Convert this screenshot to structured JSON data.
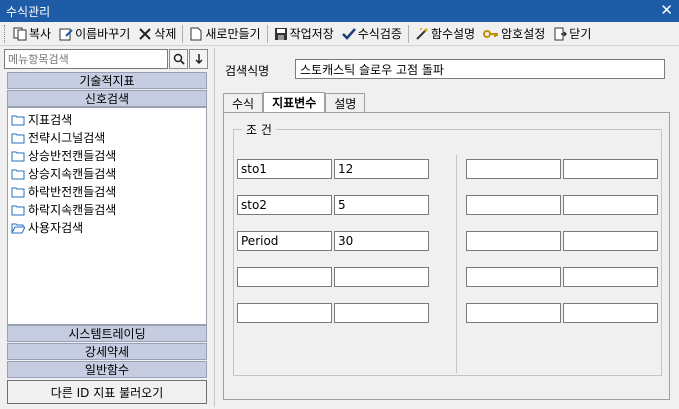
{
  "window": {
    "title": "수식관리"
  },
  "toolbar": {
    "copy": "복사",
    "rename": "이름바꾸기",
    "delete": "삭제",
    "new": "새로만들기",
    "save": "작업저장",
    "verify": "수식검증",
    "func_help": "함수설명",
    "password": "암호설정",
    "close": "닫기"
  },
  "left": {
    "search_placeholder": "메뉴항목검색",
    "categories_top": [
      "기술적지표",
      "신호검색"
    ],
    "tree": [
      "지표검색",
      "전략시그널검색",
      "상승반전캔들검색",
      "상승지속캔들검색",
      "하락반전캔들검색",
      "하락지속캔들검색",
      "사용자검색"
    ],
    "categories_bottom": [
      "시스템트레이딩",
      "강세약세",
      "일반함수"
    ],
    "load_button": "다른 ID 지표 불러오기"
  },
  "right": {
    "name_label": "검색식명",
    "name_value": "스토캐스틱 슬로우 고점 돌파",
    "tabs": [
      "수식",
      "지표변수",
      "설명"
    ],
    "active_tab": 1,
    "group_title": "조 건",
    "params": [
      {
        "name": "sto1",
        "value": "12"
      },
      {
        "name": "sto2",
        "value": "5"
      },
      {
        "name": "Period",
        "value": "30"
      },
      {
        "name": "",
        "value": ""
      },
      {
        "name": "",
        "value": ""
      }
    ]
  },
  "colors": {
    "titlebar": "#1f5ca8",
    "category_bar": "#c6cde0"
  }
}
